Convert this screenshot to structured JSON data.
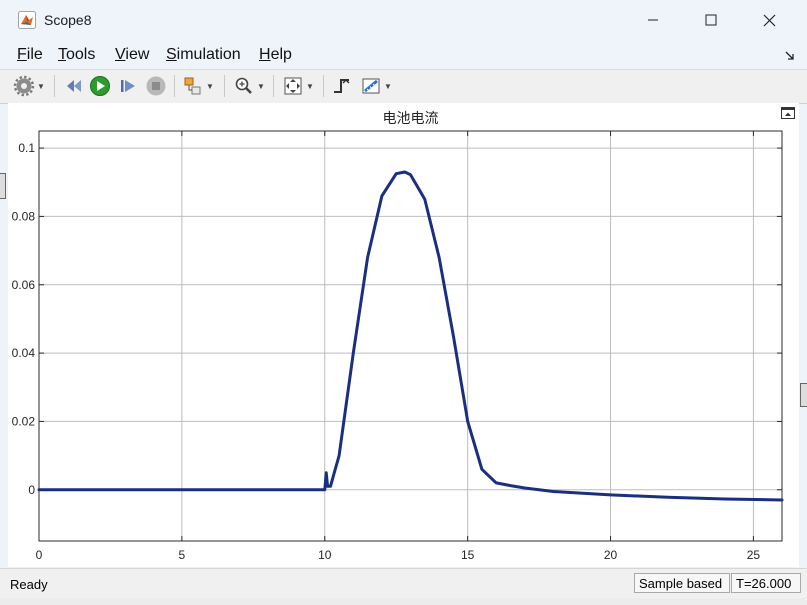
{
  "window": {
    "title": "Scope8"
  },
  "menu": [
    {
      "label": "File",
      "mnemonic": "F",
      "rest": "ile"
    },
    {
      "label": "Tools",
      "mnemonic": "T",
      "rest": "ools"
    },
    {
      "label": "View",
      "mnemonic": "V",
      "rest": "iew"
    },
    {
      "label": "Simulation",
      "mnemonic": "S",
      "rest": "imulation"
    },
    {
      "label": "Help",
      "mnemonic": "H",
      "rest": "elp"
    }
  ],
  "toolbar_icons": [
    "settings-icon",
    "restore-icon",
    "run-icon",
    "step-forward-icon",
    "stop-icon",
    "highlight-block-icon",
    "zoom-icon",
    "autoscale-icon",
    "triggers-icon",
    "measurements-icon"
  ],
  "colors": {
    "line": "#1a2f80",
    "run": "#2e9b2e",
    "accent": "#2a6fd1"
  },
  "chart_data": {
    "type": "line",
    "title": "电池电流",
    "xlim": [
      0,
      26
    ],
    "ylim": [
      -0.015,
      0.105
    ],
    "xticks": [
      0,
      5,
      10,
      15,
      20,
      25
    ],
    "yticks": [
      0,
      0.02,
      0.04,
      0.06,
      0.08,
      0.1
    ],
    "xtick_labels": [
      "0",
      "5",
      "10",
      "15",
      "20",
      "25"
    ],
    "ytick_labels": [
      "0",
      "0.02",
      "0.04",
      "0.06",
      "0.08",
      "0.1"
    ],
    "grid": true,
    "series": [
      {
        "x": [
          0,
          10,
          10.05,
          10.1,
          10.2,
          10.3,
          10.5,
          11,
          11.5,
          12,
          12.5,
          12.8,
          13,
          13.5,
          14,
          14.5,
          15,
          15.5,
          16,
          16.5,
          17,
          18,
          20,
          22,
          24,
          26
        ],
        "y": [
          0,
          0,
          0.005,
          0.001,
          0.001,
          0.004,
          0.01,
          0.04,
          0.068,
          0.086,
          0.0925,
          0.093,
          0.0922,
          0.085,
          0.068,
          0.045,
          0.02,
          0.006,
          0.002,
          0.0012,
          0.0005,
          -0.0005,
          -0.0015,
          -0.0022,
          -0.0027,
          -0.003
        ]
      }
    ]
  },
  "status": {
    "text": "Ready",
    "sample": "Sample based",
    "time": "T=26.000"
  }
}
